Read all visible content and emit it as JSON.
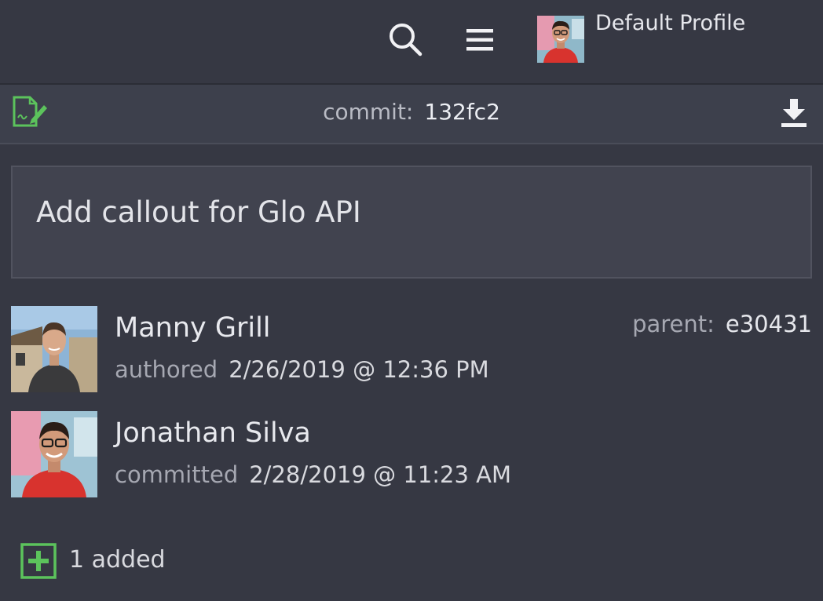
{
  "header": {
    "profile_name": "Default Profile",
    "icons": [
      "search-icon",
      "hamburger-menu-icon",
      "profile-avatar"
    ]
  },
  "commit_bar": {
    "label": "commit:",
    "sha": "132fc2",
    "icons": [
      "edit-commit-icon",
      "download-icon"
    ],
    "accent_color": "#5cc35c"
  },
  "commit": {
    "message": "Add callout for Glo API",
    "parent_label": "parent:",
    "parent_sha": "e30431",
    "author": {
      "name": "Manny Grill",
      "role": "authored",
      "date": "2/26/2019 @ 12:36 PM"
    },
    "committer": {
      "name": "Jonathan Silva",
      "role": "committed",
      "date": "2/28/2019 @ 11:23 AM"
    }
  },
  "files": {
    "added_text": "1 added",
    "icon": "plus-square-icon",
    "color": "#5cc35c"
  }
}
